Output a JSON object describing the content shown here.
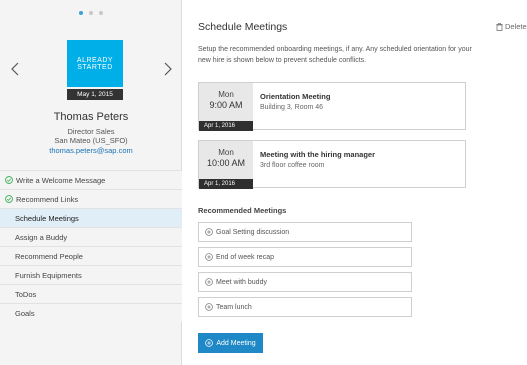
{
  "carousel": {
    "dots": 3,
    "active_index": 0
  },
  "profile": {
    "badge_line1": "ALREADY",
    "badge_line2": "STARTED",
    "start_date": "May 1, 2015",
    "name": "Thomas Peters",
    "role": "Director Sales",
    "location": "San Mateo (US_SFO)",
    "email": "thomas.peters@sap.com",
    "badge_color": "#00aee8"
  },
  "nav": {
    "items": [
      {
        "label": "Write a Welcome Message",
        "done": true
      },
      {
        "label": "Recommend Links",
        "done": true
      },
      {
        "label": "Schedule Meetings",
        "active": true
      },
      {
        "label": "Assign a Buddy"
      },
      {
        "label": "Recommend People"
      },
      {
        "label": "Furnish Equipments"
      },
      {
        "label": "ToDos"
      },
      {
        "label": "Goals"
      }
    ]
  },
  "main": {
    "title": "Schedule Meetings",
    "delete_label": "Delete",
    "description": "Setup the recommended onboarding meetings, if any. Any scheduled orientation for your new hire is shown below to prevent schedule conflicts.",
    "meetings": [
      {
        "day": "Mon",
        "time": "9:00 AM",
        "date": "Apr 1, 2016",
        "title": "Orientation Meeting",
        "location": "Building 3, Room 46"
      },
      {
        "day": "Mon",
        "time": "10:00 AM",
        "date": "Apr 1, 2016",
        "title": "Meeting with the hiring manager",
        "location": "3rd floor coffee room"
      }
    ],
    "recommended_title": "Recommended Meetings",
    "recommended": [
      "Goal Setting discussion",
      "End of week recap",
      "Meet with buddy",
      "Team lunch"
    ],
    "add_button": "Add Meeting",
    "accent_color": "#1f88c6"
  }
}
